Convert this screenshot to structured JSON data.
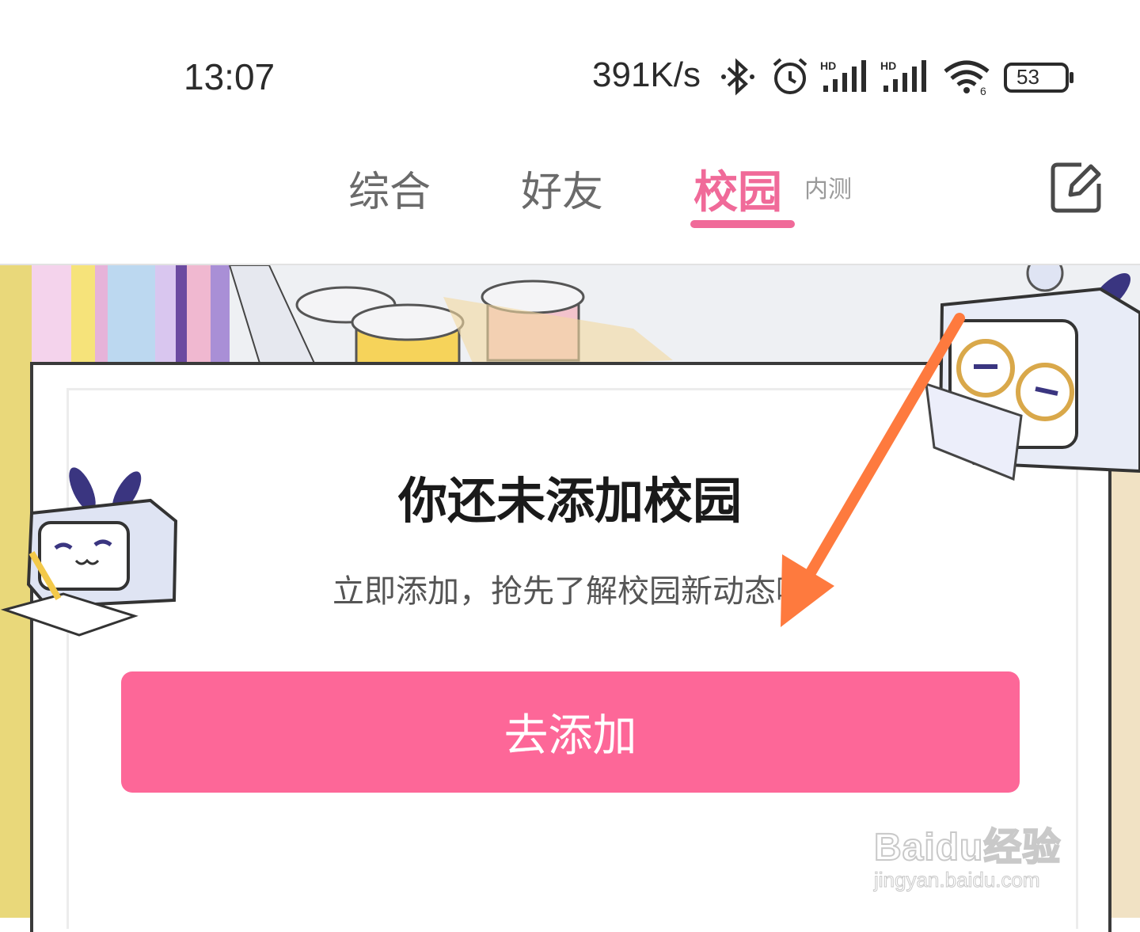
{
  "status_bar": {
    "time": "13:07",
    "net_speed": "391K/s",
    "battery": "53",
    "icons": [
      "bluetooth-icon",
      "alarm-icon",
      "signal-hd-icon",
      "signal-hd-icon",
      "wifi-icon",
      "battery-icon"
    ]
  },
  "tabs": [
    {
      "label": "综合"
    },
    {
      "label": "好友"
    },
    {
      "label": "校园",
      "badge": "内测",
      "active": true
    }
  ],
  "header": {
    "edit_icon": "edit-icon"
  },
  "empty_state": {
    "title": "你还未添加校园",
    "subtitle": "立即添加，抢先了解校园新动态哦",
    "button": "去添加"
  },
  "watermark": {
    "brand": "Baidu经验",
    "url": "jingyan.baidu.com"
  },
  "colors": {
    "accent": "#f06a99",
    "button": "#fd6798",
    "arrow": "#fe7a3e"
  }
}
